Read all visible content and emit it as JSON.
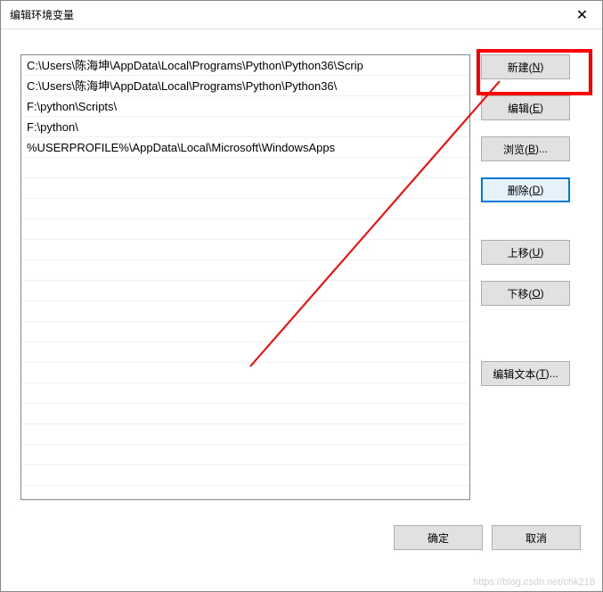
{
  "window": {
    "title": "编辑环境变量"
  },
  "list": {
    "items": [
      "C:\\Users\\陈海坤\\AppData\\Local\\Programs\\Python\\Python36\\Scrip",
      "C:\\Users\\陈海坤\\AppData\\Local\\Programs\\Python\\Python36\\",
      "F:\\python\\Scripts\\",
      "F:\\python\\",
      "%USERPROFILE%\\AppData\\Local\\Microsoft\\WindowsApps"
    ]
  },
  "buttons": {
    "new_prefix": "新建(",
    "new_key": "N",
    "new_suffix": ")",
    "edit_prefix": "编辑(",
    "edit_key": "E",
    "edit_suffix": ")",
    "browse_prefix": "浏览(",
    "browse_key": "B",
    "browse_suffix": ")...",
    "delete_prefix": "删除(",
    "delete_key": "D",
    "delete_suffix": ")",
    "moveup_prefix": "上移(",
    "moveup_key": "U",
    "moveup_suffix": ")",
    "movedown_prefix": "下移(",
    "movedown_key": "O",
    "movedown_suffix": ")",
    "edittext_prefix": "编辑文本(",
    "edittext_key": "T",
    "edittext_suffix": ")...",
    "ok": "确定",
    "cancel": "取消"
  },
  "watermark": "https://blog.csdn.net/chk218"
}
